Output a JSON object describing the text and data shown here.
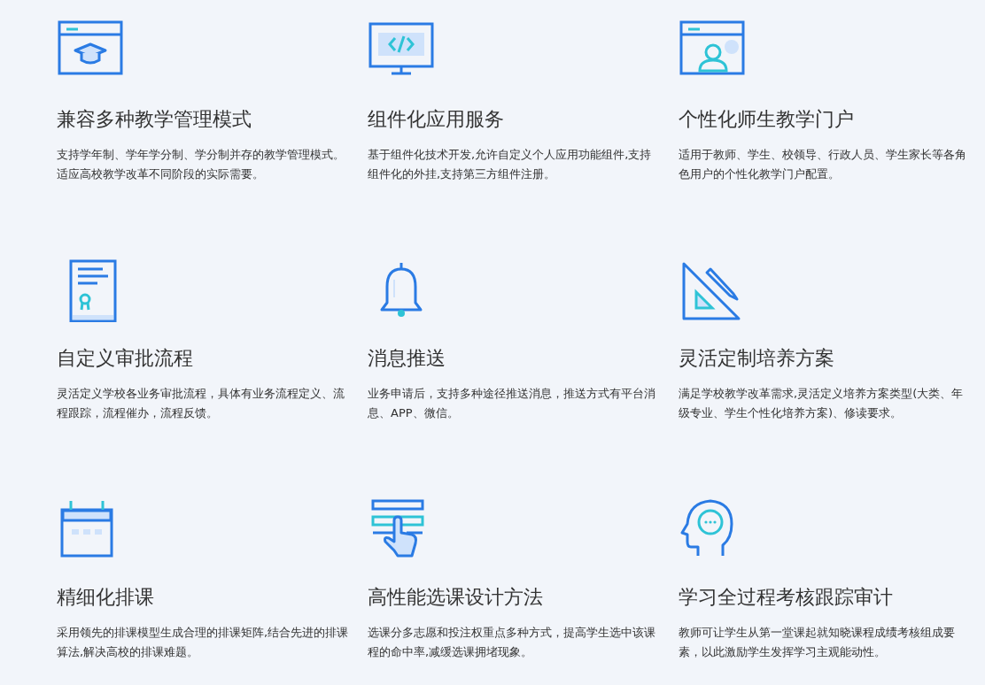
{
  "features": [
    {
      "kind": "graduation",
      "title": "兼容多种教学管理模式",
      "description": "支持学年制、学年学分制、学分制并存的教学管理模式。适应高校教学改革不同阶段的实际需要。"
    },
    {
      "kind": "code",
      "title": "组件化应用服务",
      "description": "基于组件化技术开发,允许自定义个人应用功能组件,支持组件化的外挂,支持第三方组件注册。"
    },
    {
      "kind": "portal",
      "title": "个性化师生教学门户",
      "description": "适用于教师、学生、校领导、行政人员、学生家长等各角色用户的个性化教学门户配置。"
    },
    {
      "kind": "certificate",
      "title": "自定义审批流程",
      "description": "灵活定义学校各业务审批流程，具体有业务流程定义、流程跟踪，流程催办，流程反馈。"
    },
    {
      "kind": "bell",
      "title": "消息推送",
      "description": "业务申请后，支持多种途径推送消息，推送方式有平台消息、APP、微信。"
    },
    {
      "kind": "ruler",
      "title": "灵活定制培养方案",
      "description": "满足学校教学改革需求,灵活定义培养方案类型(大类、年级专业、学生个性化培养方案)、修读要求。"
    },
    {
      "kind": "calendar",
      "title": "精细化排课",
      "description": "采用领先的排课模型生成合理的排课矩阵,结合先进的排课算法,解决高校的排课难题。"
    },
    {
      "kind": "touch",
      "title": "高性能选课设计方法",
      "description": "选课分多志愿和投注权重点多种方式，提高学生选中该课程的命中率,减缓选课拥堵现象。"
    },
    {
      "kind": "head",
      "title": "学习全过程考核跟踪审计",
      "description": "教师可让学生从第一堂课起就知晓课程成绩考核组成要素，以此激励学生发挥学习主观能动性。"
    }
  ]
}
